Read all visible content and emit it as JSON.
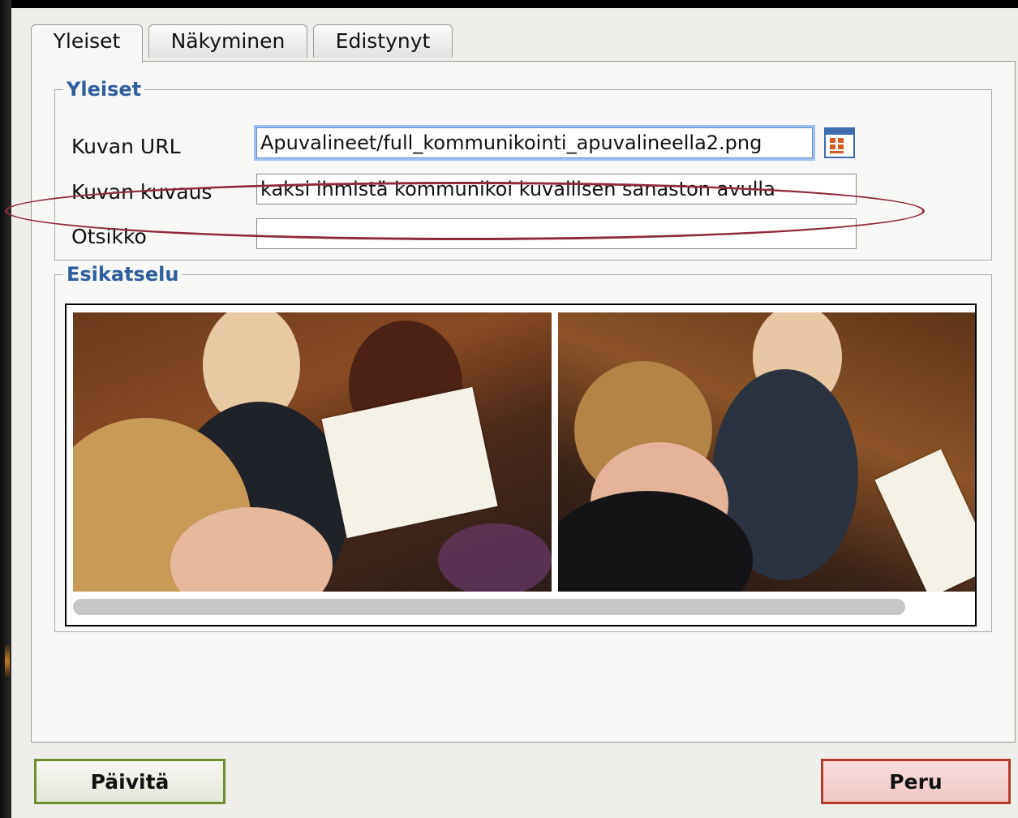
{
  "tabs": [
    {
      "label": "Yleiset",
      "active": true
    },
    {
      "label": "Näkyminen",
      "active": false
    },
    {
      "label": "Edistynyt",
      "active": false
    }
  ],
  "general": {
    "legend": "Yleiset",
    "url_label": "Kuvan URL",
    "url_value": "Apuvalineet/full_kommunikointi_apuvalineella2.png",
    "browse_icon": "file-browser-icon",
    "desc_label": "Kuvan kuvaus",
    "desc_value": "kaksi ihmistä kommunikoi kuvallisen sanaston avulla",
    "title_label": "Otsikko",
    "title_value": ""
  },
  "preview": {
    "legend": "Esikatselu"
  },
  "buttons": {
    "update": "Päivitä",
    "cancel": "Peru"
  },
  "colors": {
    "legend": "#2f5d9e",
    "highlight": "#8e2b3b",
    "update_border": "#6f8f2f",
    "cancel_border": "#b53a2a"
  }
}
